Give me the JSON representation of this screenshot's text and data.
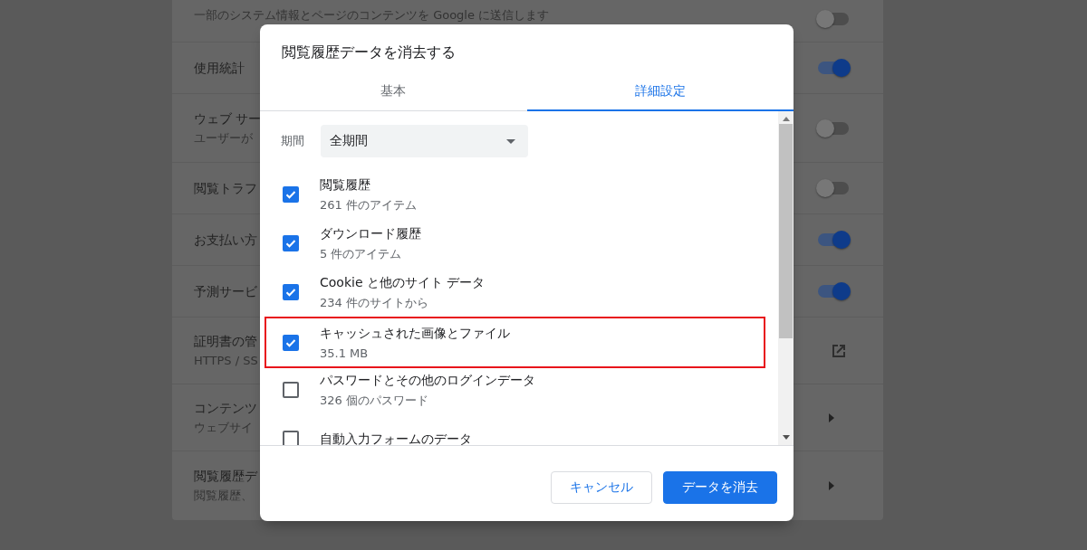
{
  "settings": {
    "rows": [
      {
        "subtitle": "一部のシステム情報とページのコンテンツを Google に送信します",
        "kind": "toggle",
        "on": false
      },
      {
        "title": "使用統計",
        "kind": "toggle",
        "on": true
      },
      {
        "title": "ウェブ サー",
        "subtitle": "ユーザーが",
        "kind": "toggle",
        "on": false
      },
      {
        "title": "閲覧トラフ",
        "kind": "toggle",
        "on": false
      },
      {
        "title": "お支払い方",
        "kind": "toggle",
        "on": true
      },
      {
        "title": "予測サービ",
        "kind": "toggle",
        "on": true
      },
      {
        "title": "証明書の管",
        "subtitle": "HTTPS / SS",
        "kind": "external"
      },
      {
        "title": "コンテンツ",
        "subtitle": "ウェブサイ",
        "kind": "submenu"
      },
      {
        "title": "閲覧履歴デ",
        "subtitle": "閲覧履歴、",
        "kind": "submenu"
      }
    ]
  },
  "dialog": {
    "title": "閲覧履歴データを消去する",
    "tabs": [
      {
        "label": "基本",
        "selected": false
      },
      {
        "label": "詳細設定",
        "selected": true
      }
    ],
    "period": {
      "label": "期間",
      "value": "全期間"
    },
    "items": [
      {
        "label": "閲覧履歴",
        "detail": "261 件のアイテム",
        "checked": true,
        "highlighted": false
      },
      {
        "label": "ダウンロード履歴",
        "detail": "5 件のアイテム",
        "checked": true,
        "highlighted": false
      },
      {
        "label": "Cookie と他のサイト データ",
        "detail": "234 件のサイトから",
        "checked": true,
        "highlighted": false
      },
      {
        "label": "キャッシュされた画像とファイル",
        "detail": "35.1 MB",
        "checked": true,
        "highlighted": true
      },
      {
        "label": "パスワードとその他のログインデータ",
        "detail": "326 個のパスワード",
        "checked": false,
        "highlighted": false
      },
      {
        "label": "自動入力フォームのデータ",
        "checked": false,
        "highlighted": false
      }
    ],
    "buttons": [
      {
        "label": "キャンセル",
        "kind": "secondary"
      },
      {
        "label": "データを消去",
        "kind": "primary"
      }
    ]
  }
}
